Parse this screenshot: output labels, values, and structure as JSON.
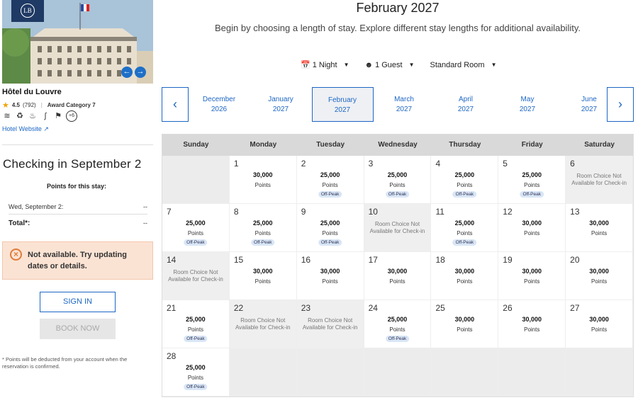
{
  "hotel": {
    "name": "Hôtel du Louvre",
    "rating": "4.5",
    "reviews": "(792)",
    "category": "Award Category 7",
    "website": "Hotel Website",
    "more_amenities": "+6"
  },
  "icons": {
    "star": "star-icon",
    "wifi": "wifi-icon",
    "dining": "dining-icon",
    "spa": "spa-icon",
    "fitness": "fitness-icon",
    "pet": "pet-icon",
    "external": "external-link-icon",
    "calendar": "calendar-icon",
    "person": "person-icon"
  },
  "left": {
    "checkin_title": "Checking in September 2",
    "points_for_stay": "Points for this stay:",
    "date_label": "Wed, September 2:",
    "date_value": "--",
    "total_label": "Total*:",
    "total_value": "--",
    "alert": "Not available. Try updating dates or details.",
    "sign_in": "SIGN IN",
    "book_now": "BOOK NOW",
    "footnote": "* Points will be deducted from your account when the reservation is confirmed."
  },
  "header": {
    "title": "February 2027",
    "subtitle": "Begin by choosing a length of stay. Explore different stay lengths for additional availability."
  },
  "filters": {
    "nights": "1 Night",
    "guests": "1 Guest",
    "room": "Standard Room"
  },
  "months": [
    {
      "m": "December",
      "y": "2026"
    },
    {
      "m": "January",
      "y": "2027"
    },
    {
      "m": "February",
      "y": "2027",
      "selected": true
    },
    {
      "m": "March",
      "y": "2027"
    },
    {
      "m": "April",
      "y": "2027"
    },
    {
      "m": "May",
      "y": "2027"
    },
    {
      "m": "June",
      "y": "2027"
    }
  ],
  "weekdays": [
    "Sunday",
    "Monday",
    "Tuesday",
    "Wednesday",
    "Thursday",
    "Friday",
    "Saturday"
  ],
  "labels": {
    "points": "Points",
    "offpeak": "Off-Peak",
    "na": "Room Choice Not Available for Check-in"
  },
  "weeks": [
    [
      null,
      {
        "d": "1",
        "p": "30,000"
      },
      {
        "d": "2",
        "p": "25,000",
        "o": true
      },
      {
        "d": "3",
        "p": "25,000",
        "o": true
      },
      {
        "d": "4",
        "p": "25,000",
        "o": true
      },
      {
        "d": "5",
        "p": "25,000",
        "o": true
      },
      {
        "d": "6",
        "na": true
      }
    ],
    [
      {
        "d": "7",
        "p": "25,000",
        "o": true
      },
      {
        "d": "8",
        "p": "25,000",
        "o": true
      },
      {
        "d": "9",
        "p": "25,000",
        "o": true
      },
      {
        "d": "10",
        "na": true
      },
      {
        "d": "11",
        "p": "25,000",
        "o": true
      },
      {
        "d": "12",
        "p": "30,000"
      },
      {
        "d": "13",
        "p": "30,000"
      }
    ],
    [
      {
        "d": "14",
        "na": true
      },
      {
        "d": "15",
        "p": "30,000"
      },
      {
        "d": "16",
        "p": "30,000"
      },
      {
        "d": "17",
        "p": "30,000"
      },
      {
        "d": "18",
        "p": "30,000"
      },
      {
        "d": "19",
        "p": "30,000"
      },
      {
        "d": "20",
        "p": "30,000"
      }
    ],
    [
      {
        "d": "21",
        "p": "25,000",
        "o": true
      },
      {
        "d": "22",
        "na": true
      },
      {
        "d": "23",
        "na": true
      },
      {
        "d": "24",
        "p": "25,000",
        "o": true
      },
      {
        "d": "25",
        "p": "30,000"
      },
      {
        "d": "26",
        "p": "30,000"
      },
      {
        "d": "27",
        "p": "30,000"
      }
    ],
    [
      {
        "d": "28",
        "p": "25,000",
        "o": true
      },
      null,
      null,
      null,
      null,
      null,
      null
    ]
  ]
}
